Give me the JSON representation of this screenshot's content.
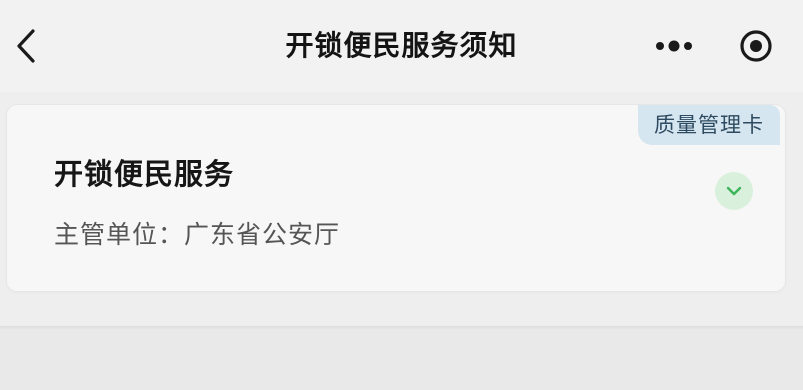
{
  "nav": {
    "title": "开锁便民服务须知",
    "back_icon": "chevron-left-icon",
    "more_icon": "more-dots-icon",
    "close_icon": "target-close-icon"
  },
  "card": {
    "badge": "质量管理卡",
    "service_name": "开锁便民服务",
    "authority_label": "主管单位：",
    "authority_value": "广东省公安厅",
    "expand_icon": "chevron-down-icon"
  },
  "colors": {
    "background": "#eeeeee",
    "card_background": "#f7f7f7",
    "badge_background": "#d6e6f1",
    "badge_text": "#2e4a60",
    "expand_background": "#d9f0dd",
    "expand_icon": "#3cb55a"
  }
}
